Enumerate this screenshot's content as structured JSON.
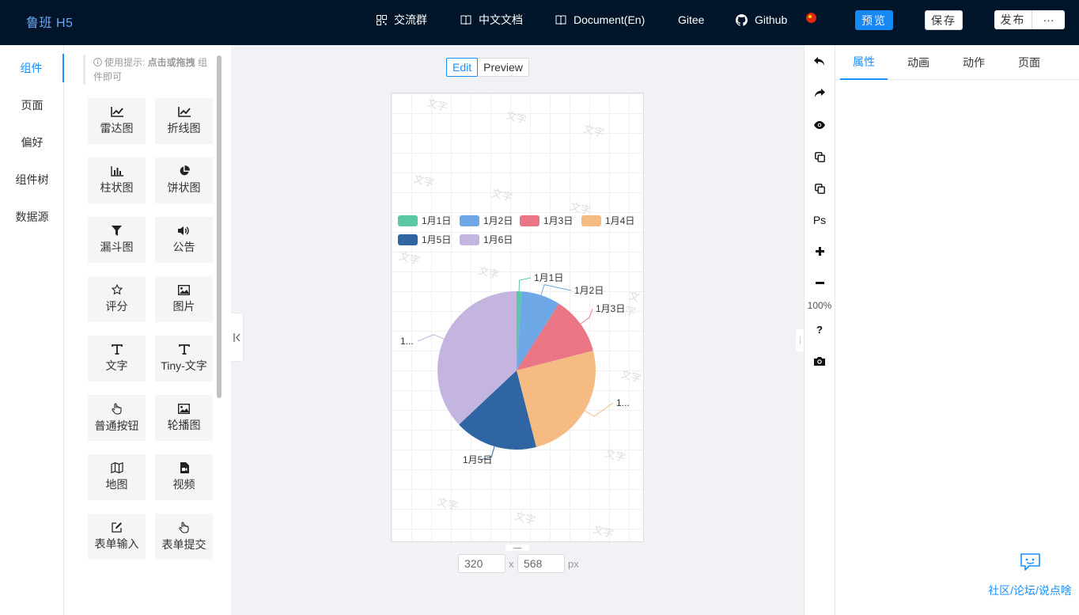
{
  "header": {
    "logo": "鲁班 H5",
    "nav": [
      "交流群",
      "中文文档",
      "Document(En)",
      "Gitee",
      "Github"
    ],
    "preview_label": "预览",
    "save_label": "保存",
    "publish_label": "发布",
    "more_label": "···"
  },
  "sidebar": {
    "items": [
      "组件",
      "页面",
      "偏好",
      "组件树",
      "数据源"
    ]
  },
  "panel": {
    "tip_prefix": "使用提示: ",
    "tip_bold": "点击或拖拽",
    "tip_suffix": " 组件即可",
    "components": [
      "雷达图",
      "折线图",
      "柱状图",
      "饼状图",
      "漏斗图",
      "公告",
      "评分",
      "图片",
      "文字",
      "Tiny-文字",
      "普通按钮",
      "轮播图",
      "地图",
      "视频",
      "表单输入",
      "表单提交"
    ]
  },
  "canvas": {
    "modes": [
      "Edit",
      "Preview"
    ],
    "width": "320",
    "height": "568",
    "times": "x",
    "unit": "px",
    "watermark": "文字"
  },
  "chart_data": {
    "type": "pie",
    "categories": [
      "1月1日",
      "1月2日",
      "1月3日",
      "1月4日",
      "1月5日",
      "1月6日"
    ],
    "values": [
      1,
      8,
      12,
      25,
      17,
      37
    ],
    "colors": [
      "#5ac8a5",
      "#6ea8e6",
      "#ea7585",
      "#f5bb82",
      "#2f65a3",
      "#c3b4e0"
    ],
    "legend_position": "top",
    "slice_labels": [
      "1月1日",
      "1月2日",
      "1月3日",
      "1...",
      "1月5日",
      "1..."
    ]
  },
  "tools": {
    "ps_label": "Ps",
    "zoom": "100%",
    "help": "?"
  },
  "props": {
    "tabs": [
      "属性",
      "动画",
      "动作",
      "页面"
    ],
    "community": "社区/论坛/说点啥"
  }
}
